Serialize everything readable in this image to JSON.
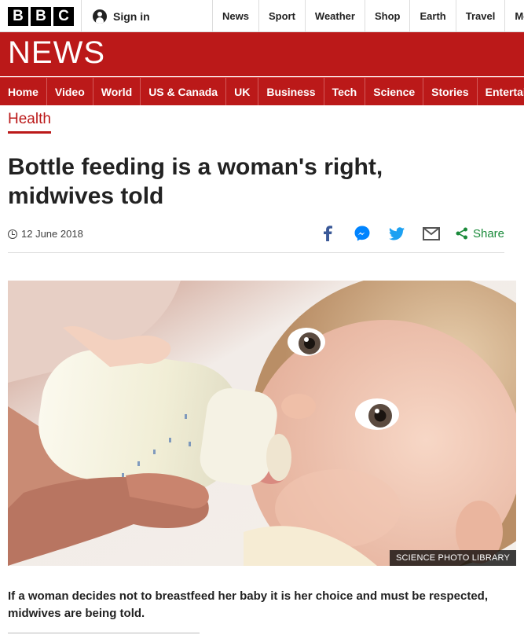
{
  "topbar": {
    "logo_letters": [
      "B",
      "B",
      "C"
    ],
    "signin_label": "Sign in",
    "nav": [
      "News",
      "Sport",
      "Weather",
      "Shop",
      "Earth",
      "Travel",
      "Mo"
    ]
  },
  "brand": {
    "news_word": "NEWS",
    "color": "#bb1919"
  },
  "section_nav": [
    "Home",
    "Video",
    "World",
    "US & Canada",
    "UK",
    "Business",
    "Tech",
    "Science",
    "Stories",
    "Entertain"
  ],
  "article": {
    "section": "Health",
    "headline": "Bottle feeding is a woman's right, midwives told",
    "date": "12 June 2018",
    "share_label": "Share",
    "image_credit": "SCIENCE PHOTO LIBRARY",
    "intro": "If a woman decides not to breastfeed her baby it is her choice and must be respected, midwives are being told."
  },
  "share_icons": [
    "facebook-icon",
    "messenger-icon",
    "twitter-icon",
    "email-icon",
    "share-icon"
  ]
}
